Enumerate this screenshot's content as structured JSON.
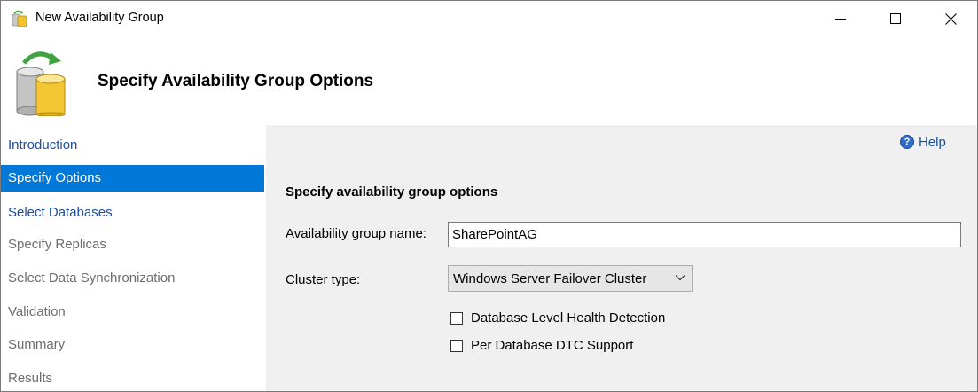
{
  "window": {
    "title": "New Availability Group",
    "controls": {
      "minimize": "minimize",
      "maximize": "maximize",
      "close": "close"
    }
  },
  "header": {
    "title": "Specify Availability Group Options"
  },
  "nav": {
    "items": [
      {
        "label": "Introduction",
        "state": "link"
      },
      {
        "label": "Specify Options",
        "state": "selected"
      },
      {
        "label": "Select Databases",
        "state": "link"
      },
      {
        "label": "Specify Replicas",
        "state": "disabled"
      },
      {
        "label": "Select Data Synchronization",
        "state": "disabled"
      },
      {
        "label": "Validation",
        "state": "disabled"
      },
      {
        "label": "Summary",
        "state": "disabled"
      },
      {
        "label": "Results",
        "state": "disabled"
      }
    ]
  },
  "main": {
    "help_label": "Help",
    "section_heading": "Specify availability group options",
    "ag_name_label": "Availability group name:",
    "ag_name_value": "SharePointAG",
    "cluster_type_label": "Cluster type:",
    "cluster_type_value": "Windows Server Failover Cluster",
    "checkboxes": [
      {
        "label": "Database Level Health Detection",
        "checked": false
      },
      {
        "label": "Per Database DTC Support",
        "checked": false
      }
    ]
  },
  "colors": {
    "selected_bg": "#0078d7",
    "link": "#1a4e9c",
    "disabled_text": "#6d6d6d",
    "panel_bg": "#f0f0f0"
  },
  "icons": [
    "database-ag-icon",
    "help-icon",
    "chevron-down-icon",
    "minimize-icon",
    "maximize-icon",
    "close-icon"
  ]
}
